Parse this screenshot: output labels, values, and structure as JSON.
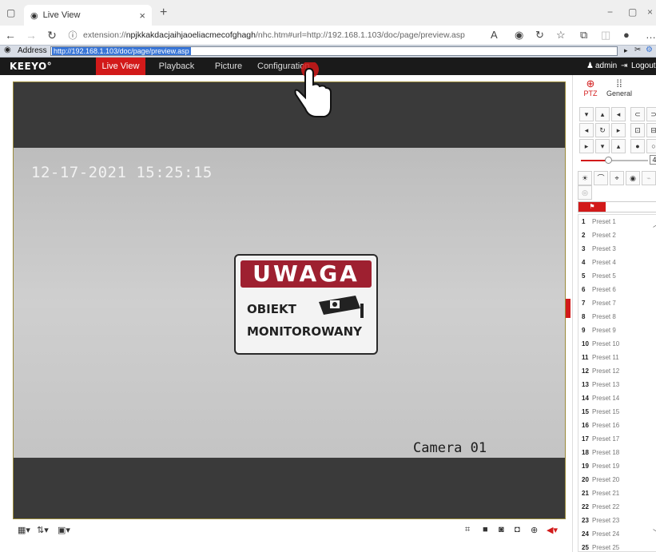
{
  "browser": {
    "tab_title": "Live View",
    "tab_close": "×",
    "new_tab": "+",
    "url_prefix": "extension://",
    "url_id": "npjkkakdacjaihjaoeliacmecofghagh",
    "url_rest": "/nhc.htm#url=http://192.168.1.103/doc/page/preview.asp",
    "win_min": "−",
    "win_max": "▢",
    "win_close": "×"
  },
  "ie": {
    "address_label": "Address",
    "address_value": "http://192.168.1.103/doc/page/preview.asp"
  },
  "app": {
    "logo": "KEEYO°",
    "nav": [
      "Live View",
      "Playback",
      "Picture",
      "Configuration"
    ],
    "active_tab": "Live View",
    "user": "admin",
    "logout": "Logout"
  },
  "video": {
    "timestamp": "12-17-2021 15:25:15",
    "camera_label": "Camera 01",
    "sign_heading": "UWAGA",
    "sign_line1": "OBIEKT",
    "sign_line2": "MONITOROWANY"
  },
  "panel": {
    "tabs": [
      {
        "label": "PTZ",
        "icon": "ptz-icon"
      },
      {
        "label": "General",
        "icon": "grid-icon"
      }
    ],
    "active_tab": "PTZ",
    "speed_value": "4",
    "speed_level": 0.4,
    "presets": [
      {
        "n": "1",
        "label": "Preset 1"
      },
      {
        "n": "2",
        "label": "Preset 2"
      },
      {
        "n": "3",
        "label": "Preset 3"
      },
      {
        "n": "4",
        "label": "Preset 4"
      },
      {
        "n": "5",
        "label": "Preset 5"
      },
      {
        "n": "6",
        "label": "Preset 6"
      },
      {
        "n": "7",
        "label": "Preset 7"
      },
      {
        "n": "8",
        "label": "Preset 8"
      },
      {
        "n": "9",
        "label": "Preset 9"
      },
      {
        "n": "10",
        "label": "Preset 10"
      },
      {
        "n": "11",
        "label": "Preset 11"
      },
      {
        "n": "12",
        "label": "Preset 12"
      },
      {
        "n": "13",
        "label": "Preset 13"
      },
      {
        "n": "14",
        "label": "Preset 14"
      },
      {
        "n": "15",
        "label": "Preset 15"
      },
      {
        "n": "16",
        "label": "Preset 16"
      },
      {
        "n": "17",
        "label": "Preset 17"
      },
      {
        "n": "18",
        "label": "Preset 18"
      },
      {
        "n": "19",
        "label": "Preset 19"
      },
      {
        "n": "20",
        "label": "Preset 20"
      },
      {
        "n": "21",
        "label": "Preset 21"
      },
      {
        "n": "22",
        "label": "Preset 22"
      },
      {
        "n": "23",
        "label": "Preset 23"
      },
      {
        "n": "24",
        "label": "Preset 24"
      },
      {
        "n": "25",
        "label": "Preset 25"
      }
    ]
  },
  "colors": {
    "accent": "#d21a1a",
    "header": "#1a1a1a",
    "sign_red": "#9e2030"
  }
}
